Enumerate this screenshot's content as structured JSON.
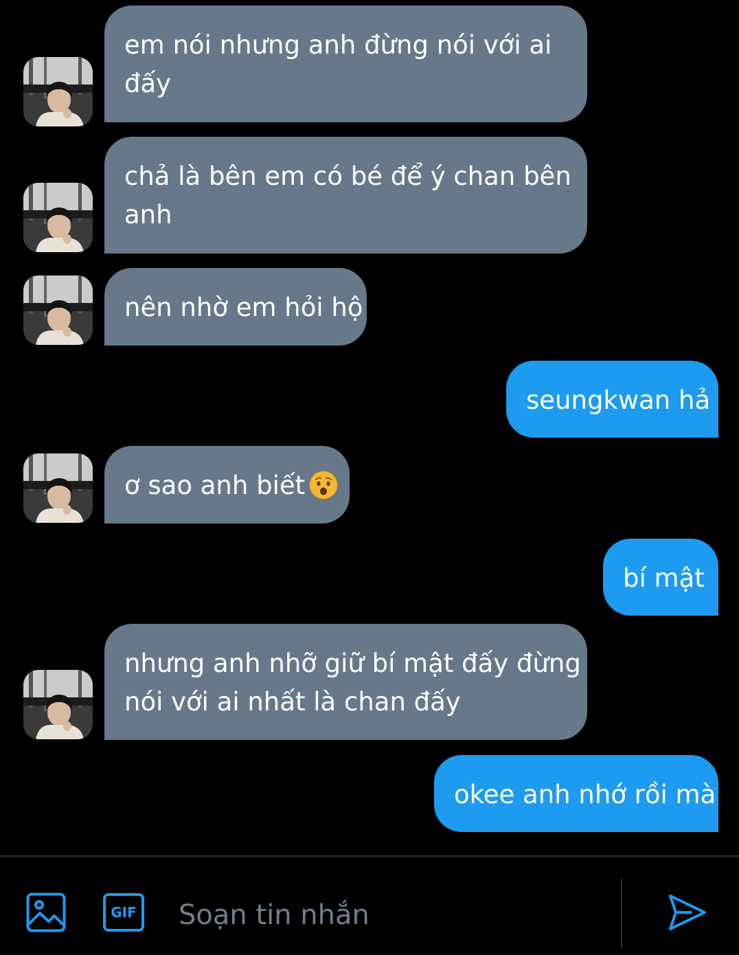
{
  "messages": [
    {
      "side": "in",
      "lines": [
        "em nói nhưng anh đừng nói với ai",
        "đấy"
      ]
    },
    {
      "side": "in",
      "lines": [
        "chả là bên em có bé để ý chan bên",
        "anh"
      ]
    },
    {
      "side": "in",
      "lines": [
        "nên nhờ em hỏi hộ"
      ]
    },
    {
      "side": "out",
      "lines": [
        "seungkwan hả"
      ]
    },
    {
      "side": "in",
      "lines": [
        "ơ sao anh biết"
      ],
      "emoji": "hushed-face"
    },
    {
      "side": "out",
      "lines": [
        "bí mật"
      ]
    },
    {
      "side": "in",
      "lines": [
        "nhưng anh nhỡ giữ bí mật đấy đừng",
        "nói với ai nhất là chan đấy"
      ]
    },
    {
      "side": "out",
      "lines": [
        "okee anh nhớ rồi mà"
      ]
    }
  ],
  "composer": {
    "placeholder": "Soạn tin nhắn",
    "gif_label": "GIF",
    "icons": [
      "image-icon",
      "gif-icon",
      "send-icon"
    ]
  },
  "colors": {
    "incoming_bubble": "#66788a",
    "outgoing_bubble": "#1d9bf0",
    "accent": "#1d9bf0",
    "background": "#000000"
  }
}
